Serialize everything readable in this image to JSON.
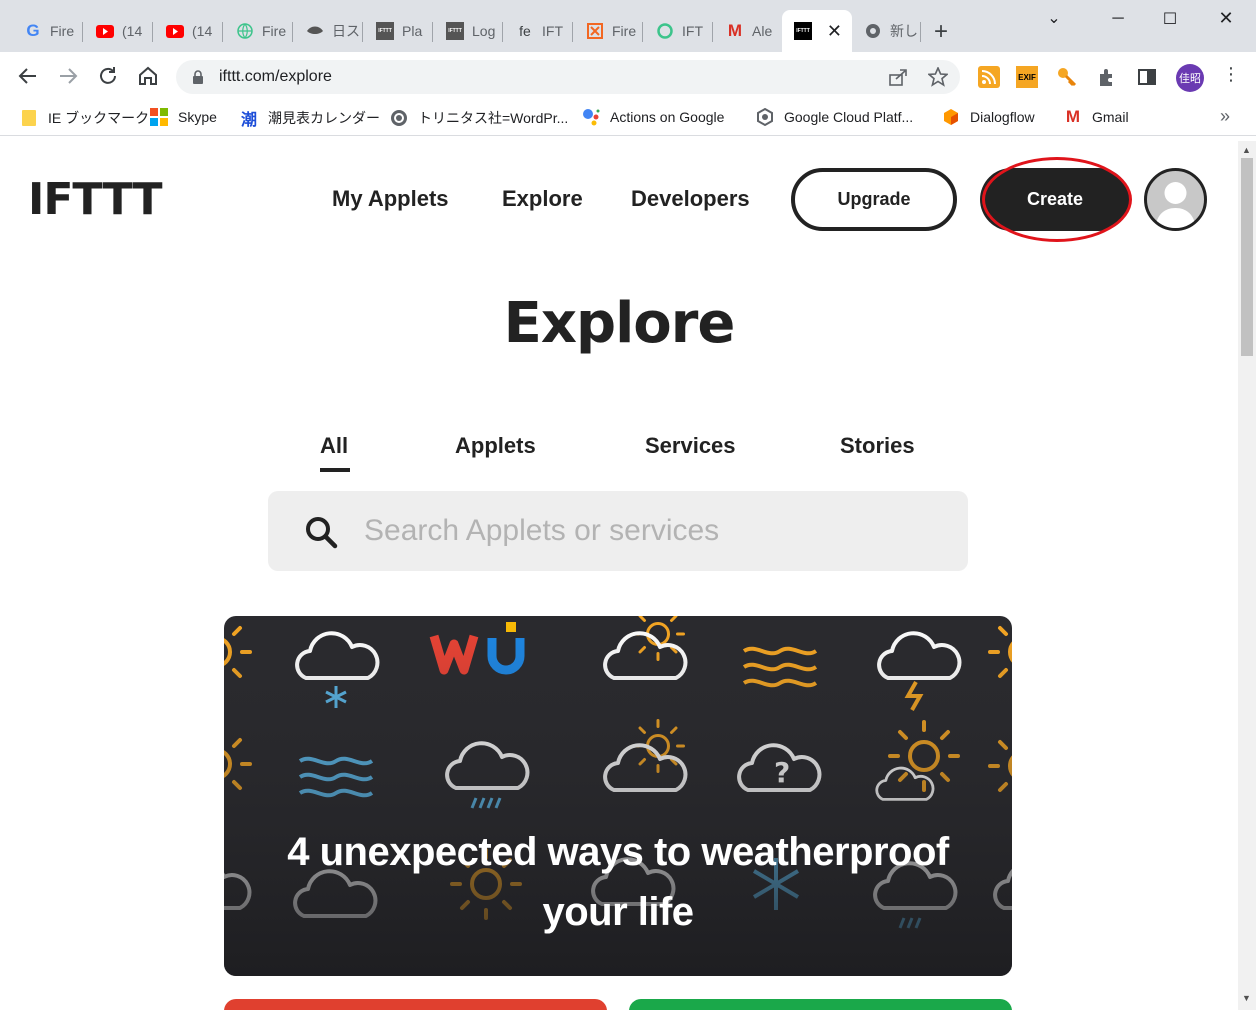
{
  "browser": {
    "tabs": [
      {
        "label": "Fire",
        "icon": "google-icon"
      },
      {
        "label": "(14",
        "icon": "youtube-icon"
      },
      {
        "label": "(14",
        "icon": "youtube-icon"
      },
      {
        "label": "Fire",
        "icon": "globe-icon"
      },
      {
        "label": "日ス",
        "icon": "bird-icon"
      },
      {
        "label": "Pla",
        "icon": "ifttt-icon"
      },
      {
        "label": "Log",
        "icon": "ifttt-icon"
      },
      {
        "label": "IFT",
        "icon": "fe-icon"
      },
      {
        "label": "Fire",
        "icon": "grid-icon"
      },
      {
        "label": "IFT",
        "icon": "circle-icon"
      },
      {
        "label": "Ale",
        "icon": "gmail-icon"
      },
      {
        "label": "",
        "icon": "ifttt-icon",
        "active": true
      },
      {
        "label": "新し",
        "icon": "chrome-icon"
      }
    ],
    "url": "ifttt.com/explore",
    "profile_initials": "佳昭",
    "bookmarks": [
      {
        "label": "IE ブックマーク",
        "icon": "folder-icon"
      },
      {
        "label": "Skype",
        "icon": "windows-icon"
      },
      {
        "label": "潮見表カレンダー",
        "icon": "kanji-icon",
        "glyph": "潮"
      },
      {
        "label": "トリニタス社=WordPr...",
        "icon": "wordpress-icon"
      },
      {
        "label": "Actions on Google",
        "icon": "assistant-icon"
      },
      {
        "label": "Google Cloud Platf...",
        "icon": "gcp-icon"
      },
      {
        "label": "Dialogflow",
        "icon": "dialogflow-icon"
      },
      {
        "label": "Gmail",
        "icon": "gmail-icon"
      }
    ],
    "exif_label": "EXIF"
  },
  "header": {
    "logo": "IFTTT",
    "nav": [
      "My Applets",
      "Explore",
      "Developers"
    ],
    "upgrade_label": "Upgrade",
    "create_label": "Create"
  },
  "main": {
    "title": "Explore",
    "filter_tabs": [
      "All",
      "Applets",
      "Services",
      "Stories"
    ],
    "active_tab": "All",
    "search_placeholder": "Search Applets or services",
    "story": {
      "title": "4 unexpected ways to weatherproof your life",
      "brand": "wu"
    }
  },
  "colors": {
    "accent_ring": "#e0141b",
    "dark": "#222222",
    "story_bg": "#2a2a2e",
    "card_red": "#e0402f",
    "card_green": "#1aa84a",
    "weather_orange": "#f5a623"
  }
}
